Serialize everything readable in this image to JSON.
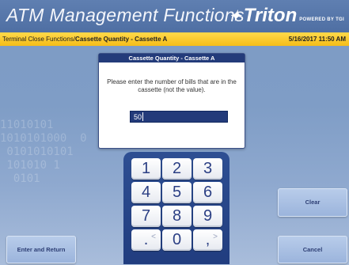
{
  "header": {
    "title": "ATM Management Functions",
    "brand_name": "Triton",
    "brand_tagline": "POWERED BY TGI"
  },
  "crumbs": {
    "path": "Terminal Close Functions/",
    "current": "Cassette Quantity - Cassette A",
    "datetime": "5/16/2017  11:50 AM"
  },
  "background_digits": "11010101\n1010101000  0\n 0101010101\n 101010 1\n  0101",
  "dialog": {
    "title": "Cassette Quantity - Cassette A",
    "message": "Please enter the number of bills that are in the cassette (not the value).",
    "input_value": "50"
  },
  "keypad": {
    "keys": [
      "1",
      "2",
      "3",
      "4",
      "5",
      "6",
      "7",
      "8",
      "9",
      ".",
      "0",
      ","
    ],
    "left_arrow": "<",
    "right_arrow": ">"
  },
  "buttons": {
    "clear": "Clear",
    "enter_return": "Enter and Return",
    "cancel": "Cancel"
  }
}
